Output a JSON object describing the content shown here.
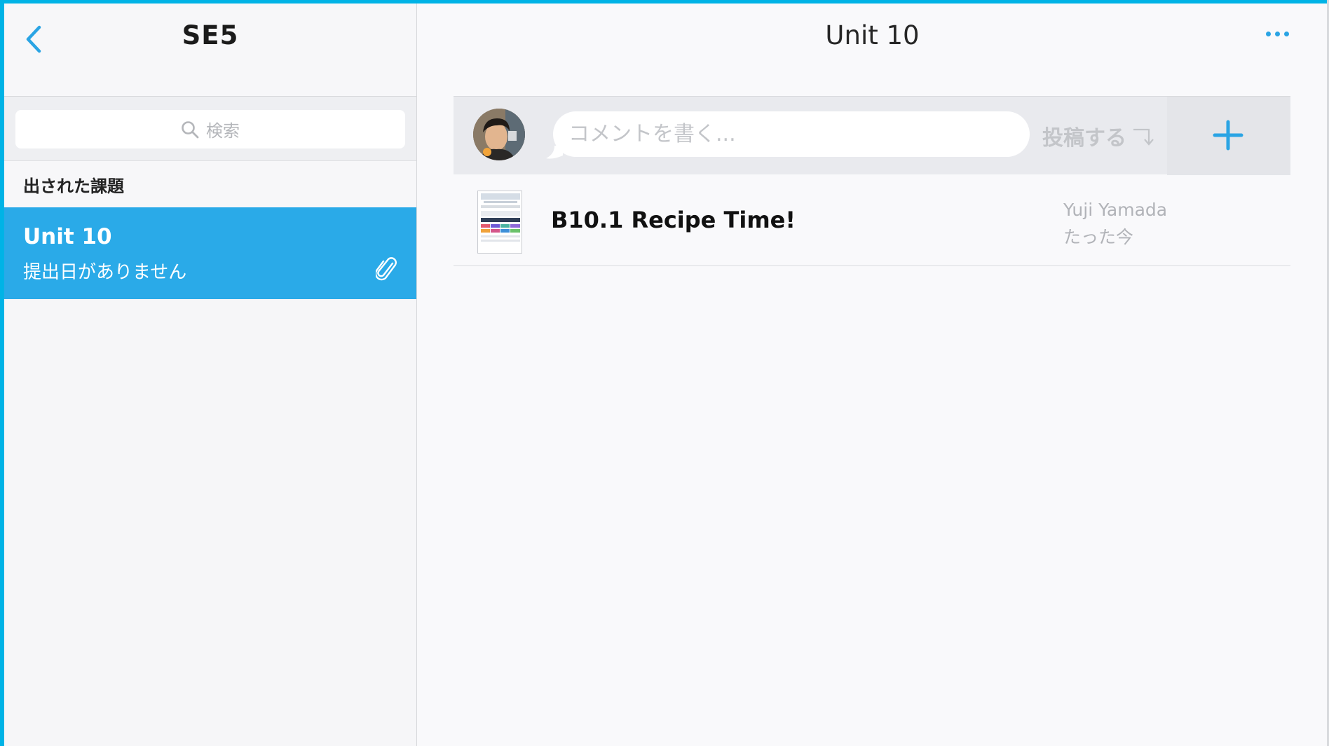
{
  "sidebar": {
    "title": "SE5",
    "search_placeholder": "検索",
    "section_header": "出された課題",
    "items": [
      {
        "title": "Unit 10",
        "subtitle": "提出日がありません"
      }
    ]
  },
  "main": {
    "title": "Unit 10",
    "composer": {
      "placeholder": "コメントを書く...",
      "post_label": "投稿する"
    },
    "posts": [
      {
        "title": "B10.1 Recipe Time!",
        "author": "Yuji Yamada",
        "time": "たった今"
      }
    ]
  },
  "colors": {
    "accent": "#2aa4e4",
    "selected_row": "#2aaae8",
    "frame": "#00b3e6"
  },
  "icons": [
    "back-chevron-icon",
    "search-icon",
    "paperclip-icon",
    "more-icon",
    "return-icon",
    "plus-icon"
  ]
}
